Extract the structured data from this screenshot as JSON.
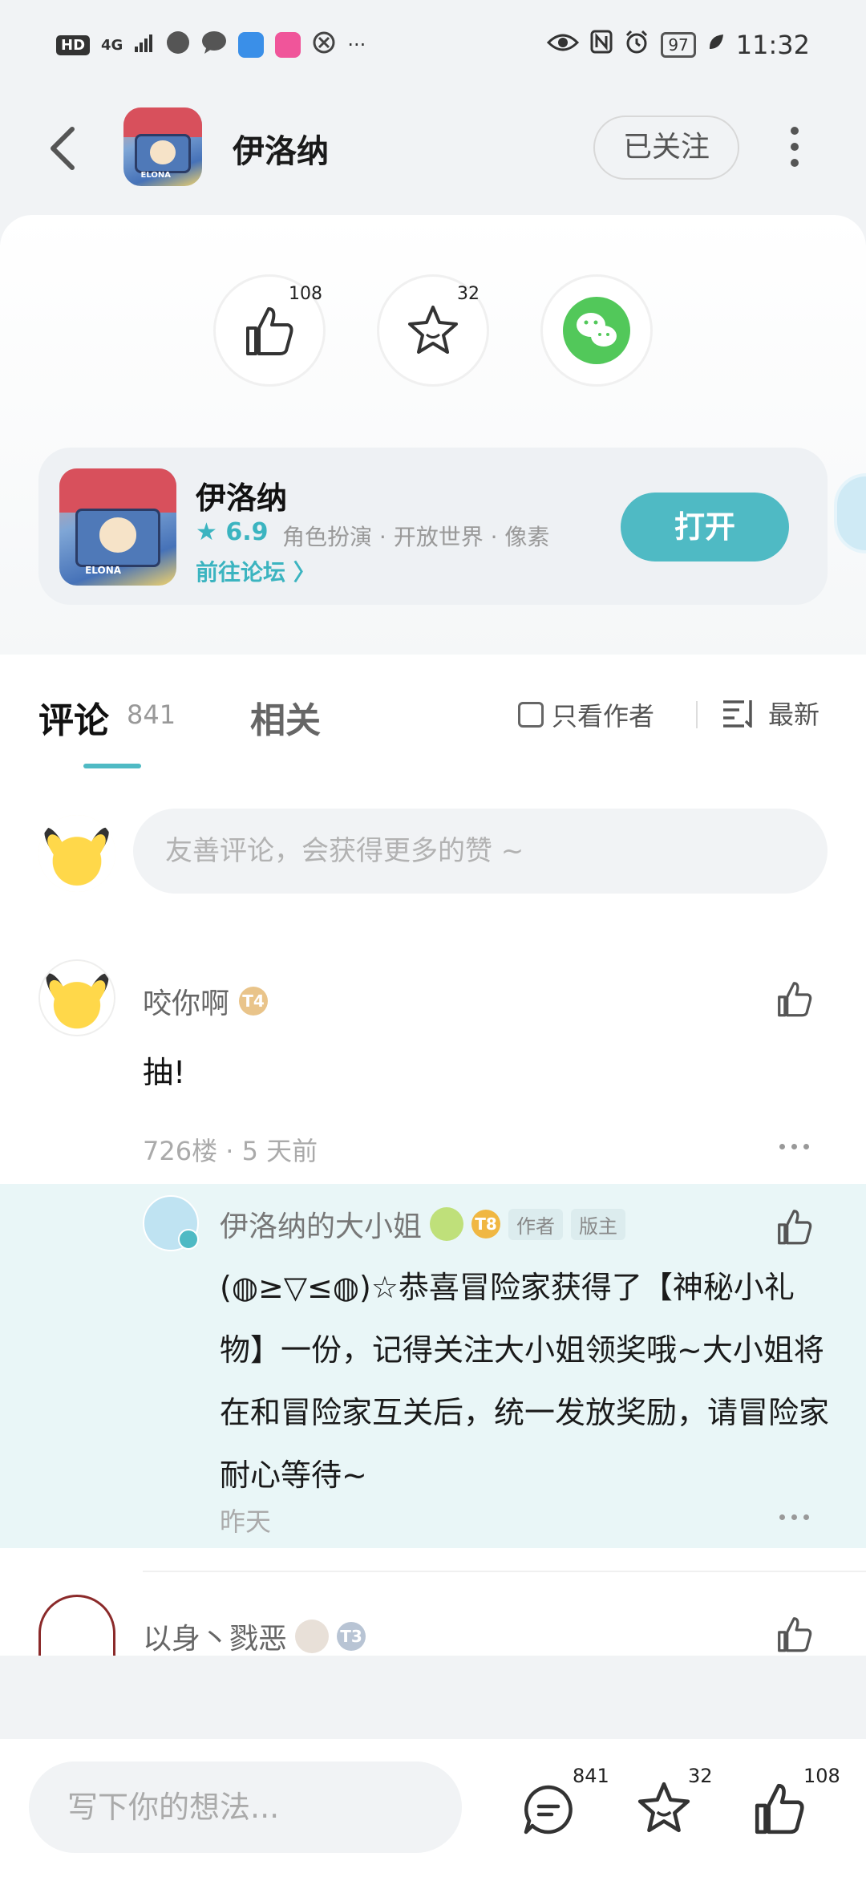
{
  "status_bar": {
    "left_text": "HD",
    "signal": "4G",
    "more": "···",
    "battery": "97",
    "time": "11:32"
  },
  "header": {
    "title": "伊洛纳",
    "follow_label": "已关注"
  },
  "actions": {
    "like_count": "108",
    "star_count": "32"
  },
  "game_card": {
    "name": "伊洛纳",
    "rating": "6.9",
    "tags": "角色扮演 · 开放世界 · 像素",
    "forum_link": "前往论坛",
    "open_label": "打开",
    "icon_text": "ELONA"
  },
  "tabs": {
    "comment_label": "评论",
    "comment_count": "841",
    "related_label": "相关",
    "only_author": "只看作者",
    "sort_label": "最新"
  },
  "comment_input": {
    "placeholder": "友善评论，会获得更多的赞 ~"
  },
  "comments": [
    {
      "user": "咬你啊",
      "level": "T4",
      "text": "抽!",
      "meta": "726楼 · 5 天前"
    }
  ],
  "reply": {
    "user": "伊洛纳的大小姐",
    "level": "T8",
    "tag_author": "作者",
    "tag_mod": "版主",
    "text": "(◍≥▽≤◍)☆恭喜冒险家获得了【神秘小礼物】一份，记得关注大小姐领奖哦~大小姐将在和冒险家互关后，统一发放奖励，请冒险家耐心等待~",
    "time": "昨天"
  },
  "next_comment": {
    "user": "以身丶戮恶",
    "level": "T3"
  },
  "bottom_bar": {
    "placeholder": "写下你的想法...",
    "comment_count": "841",
    "star_count": "32",
    "like_count": "108"
  },
  "colors": {
    "accent": "#4fbac4",
    "rating": "#3bb4c0",
    "wechat": "#52c85a",
    "reply_bg": "#e9f6f7"
  }
}
